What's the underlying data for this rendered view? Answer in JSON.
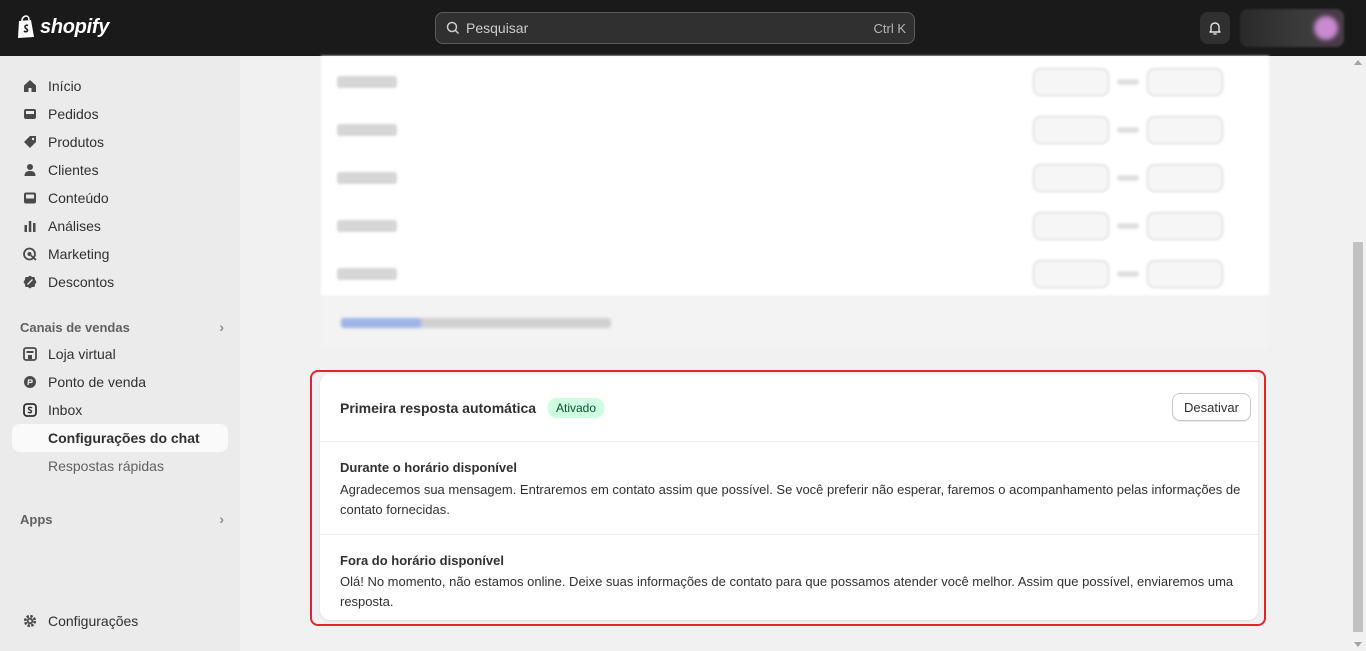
{
  "brand": {
    "name": "shopify"
  },
  "search": {
    "placeholder": "Pesquisar",
    "shortcut": "Ctrl K"
  },
  "sidebar": {
    "items": [
      {
        "label": "Início",
        "icon": "home-icon"
      },
      {
        "label": "Pedidos",
        "icon": "inbox-tray-icon"
      },
      {
        "label": "Produtos",
        "icon": "tag-icon"
      },
      {
        "label": "Clientes",
        "icon": "person-icon"
      },
      {
        "label": "Conteúdo",
        "icon": "image-icon"
      },
      {
        "label": "Análises",
        "icon": "bar-chart-icon"
      },
      {
        "label": "Marketing",
        "icon": "target-icon"
      },
      {
        "label": "Descontos",
        "icon": "discount-icon"
      }
    ],
    "sales_channels_label": "Canais de vendas",
    "channels": [
      {
        "label": "Loja virtual",
        "icon": "store-icon"
      },
      {
        "label": "Ponto de venda",
        "icon": "pos-icon"
      },
      {
        "label": "Inbox",
        "icon": "inbox-app-icon"
      }
    ],
    "inbox_sub": [
      {
        "label": "Configurações do chat"
      },
      {
        "label": "Respostas rápidas"
      }
    ],
    "apps_label": "Apps",
    "settings_label": "Configurações"
  },
  "card": {
    "title": "Primeira resposta automática",
    "badge": "Ativado",
    "button": "Desativar",
    "sections": [
      {
        "title": "Durante o horário disponível",
        "text": "Agradecemos sua mensagem. Entraremos em contato assim que possível. Se você preferir não esperar, faremos o acompanhamento pelas informações de contato fornecidas."
      },
      {
        "title": "Fora do horário disponível",
        "text": "Olá! No momento, não estamos online. Deixe suas informações de contato para que possamos atender você melhor. Assim que possível, enviaremos uma resposta."
      }
    ]
  },
  "colors": {
    "topbar": "#1a1a1a",
    "badge_bg": "#cdfee1",
    "badge_text": "#0c5132",
    "highlight": "#e0262c"
  }
}
